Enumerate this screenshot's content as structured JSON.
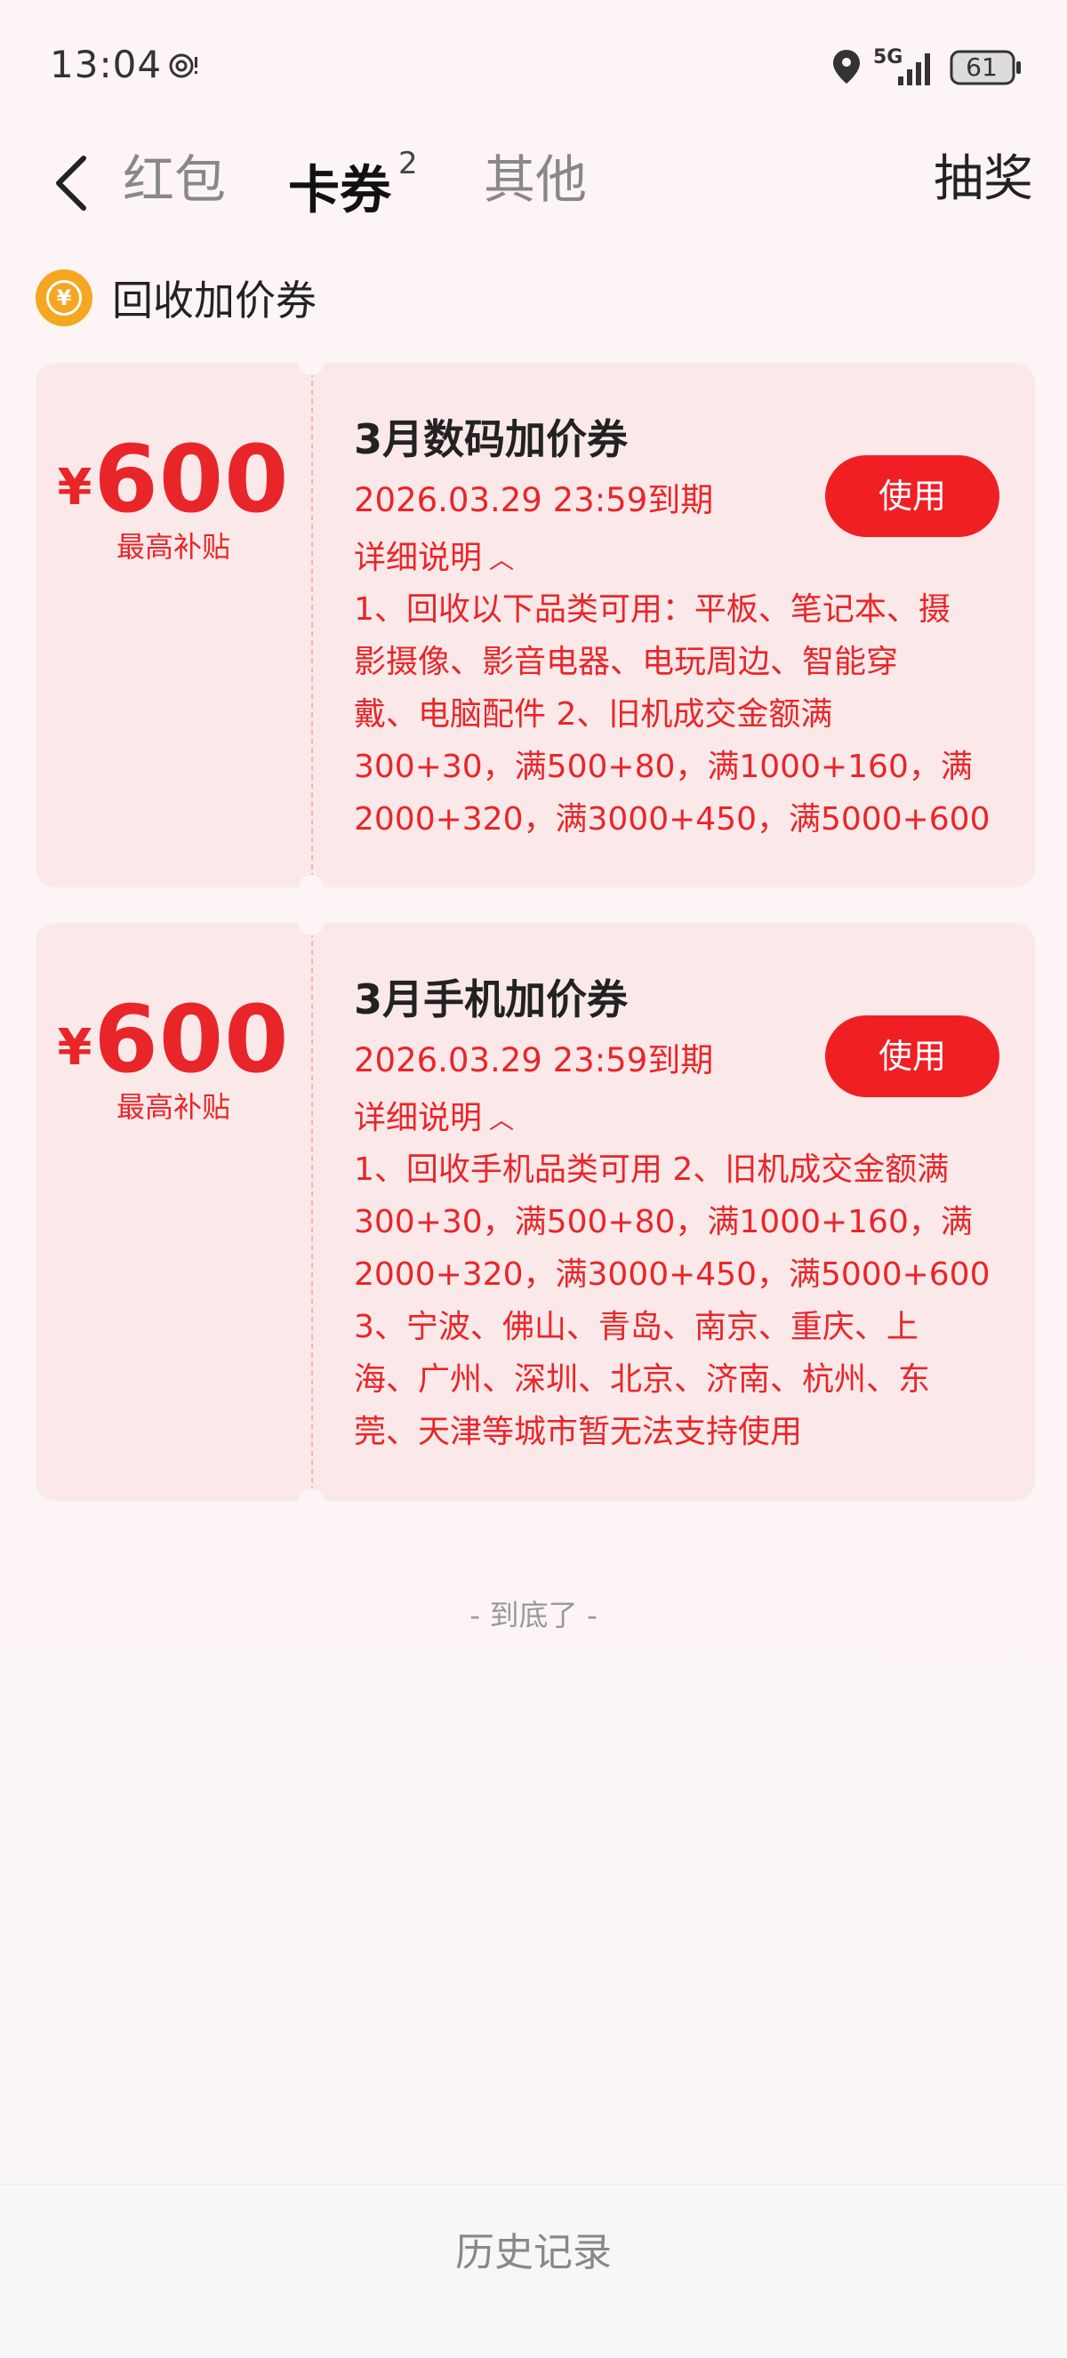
{
  "status_bar": {
    "time": "13:04",
    "network_label": "5G",
    "battery_level": "61"
  },
  "nav": {
    "tabs": [
      {
        "label": "红包",
        "active": false
      },
      {
        "label": "卡券",
        "active": true,
        "badge": "2"
      },
      {
        "label": "其他",
        "active": false
      }
    ],
    "right_action": "抽奖"
  },
  "section": {
    "title": "回收加价券",
    "icon": "yen-coin-icon",
    "icon_symbol": "¥"
  },
  "coupons": [
    {
      "currency": "¥",
      "amount": "600",
      "amount_caption": "最高补贴",
      "title": "3月数码加价券",
      "expire": "2026.03.29 23:59到期",
      "detail_label": "详细说明",
      "detail_text": "1、回收以下品类可用：平板、笔记本、摄\n影摄像、影音电器、电玩周边、智能穿\n戴、电脑配件 2、旧机成交金额满\n300+30，满500+80，满1000+160，满\n2000+320，满3000+450，满5000+600",
      "button_label": "使用"
    },
    {
      "currency": "¥",
      "amount": "600",
      "amount_caption": "最高补贴",
      "title": "3月手机加价券",
      "expire": "2026.03.29 23:59到期",
      "detail_label": "详细说明",
      "detail_text": "1、回收手机品类可用 2、旧机成交金额满\n300+30，满500+80，满1000+160，满\n2000+320，满3000+450，满5000+600\n3、宁波、佛山、青岛、南京、重庆、上\n海、广州、深圳、北京、济南、杭州、东\n莞、天津等城市暂无法支持使用",
      "button_label": "使用"
    }
  ],
  "end_tip": "- 到底了 -",
  "bottom": {
    "history_label": "历史记录"
  },
  "colors": {
    "accent": "#e8262a",
    "button": "#f01f24",
    "card_bg": "#fbe9e9",
    "coin": "#f5a623"
  }
}
